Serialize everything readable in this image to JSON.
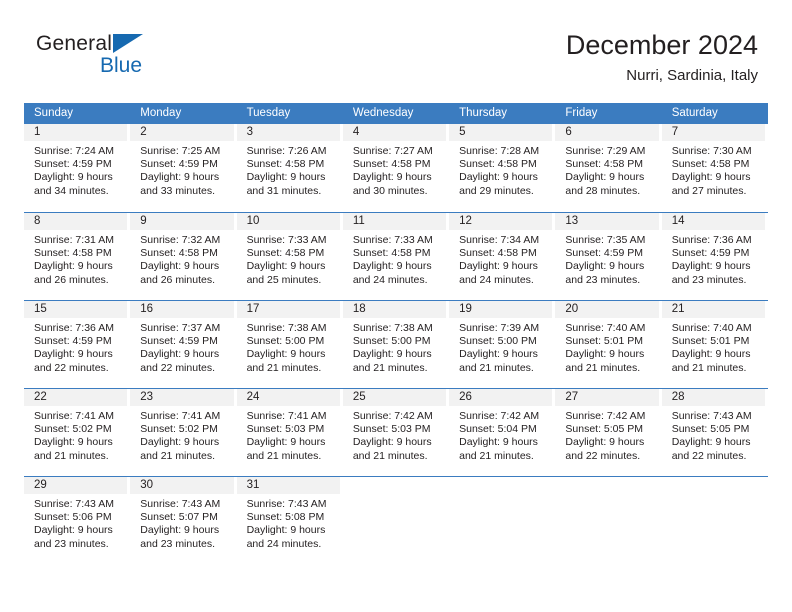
{
  "brand": {
    "line1": "General",
    "line2": "Blue",
    "triangle_color": "#1669b0"
  },
  "header": {
    "title": "December 2024",
    "subtitle": "Nurri, Sardinia, Italy",
    "accent_color": "#3b7cc0",
    "day_band_color": "#f2f2f2"
  },
  "weekday_headers": [
    "Sunday",
    "Monday",
    "Tuesday",
    "Wednesday",
    "Thursday",
    "Friday",
    "Saturday"
  ],
  "labels": {
    "sunrise_prefix": "Sunrise:",
    "sunset_prefix": "Sunset:",
    "daylight_prefix": "Daylight:"
  },
  "weeks": [
    [
      {
        "day": "1",
        "sunrise": "Sunrise: 7:24 AM",
        "sunset": "Sunset: 4:59 PM",
        "daylight_1": "Daylight: 9 hours",
        "daylight_2": "and 34 minutes."
      },
      {
        "day": "2",
        "sunrise": "Sunrise: 7:25 AM",
        "sunset": "Sunset: 4:59 PM",
        "daylight_1": "Daylight: 9 hours",
        "daylight_2": "and 33 minutes."
      },
      {
        "day": "3",
        "sunrise": "Sunrise: 7:26 AM",
        "sunset": "Sunset: 4:58 PM",
        "daylight_1": "Daylight: 9 hours",
        "daylight_2": "and 31 minutes."
      },
      {
        "day": "4",
        "sunrise": "Sunrise: 7:27 AM",
        "sunset": "Sunset: 4:58 PM",
        "daylight_1": "Daylight: 9 hours",
        "daylight_2": "and 30 minutes."
      },
      {
        "day": "5",
        "sunrise": "Sunrise: 7:28 AM",
        "sunset": "Sunset: 4:58 PM",
        "daylight_1": "Daylight: 9 hours",
        "daylight_2": "and 29 minutes."
      },
      {
        "day": "6",
        "sunrise": "Sunrise: 7:29 AM",
        "sunset": "Sunset: 4:58 PM",
        "daylight_1": "Daylight: 9 hours",
        "daylight_2": "and 28 minutes."
      },
      {
        "day": "7",
        "sunrise": "Sunrise: 7:30 AM",
        "sunset": "Sunset: 4:58 PM",
        "daylight_1": "Daylight: 9 hours",
        "daylight_2": "and 27 minutes."
      }
    ],
    [
      {
        "day": "8",
        "sunrise": "Sunrise: 7:31 AM",
        "sunset": "Sunset: 4:58 PM",
        "daylight_1": "Daylight: 9 hours",
        "daylight_2": "and 26 minutes."
      },
      {
        "day": "9",
        "sunrise": "Sunrise: 7:32 AM",
        "sunset": "Sunset: 4:58 PM",
        "daylight_1": "Daylight: 9 hours",
        "daylight_2": "and 26 minutes."
      },
      {
        "day": "10",
        "sunrise": "Sunrise: 7:33 AM",
        "sunset": "Sunset: 4:58 PM",
        "daylight_1": "Daylight: 9 hours",
        "daylight_2": "and 25 minutes."
      },
      {
        "day": "11",
        "sunrise": "Sunrise: 7:33 AM",
        "sunset": "Sunset: 4:58 PM",
        "daylight_1": "Daylight: 9 hours",
        "daylight_2": "and 24 minutes."
      },
      {
        "day": "12",
        "sunrise": "Sunrise: 7:34 AM",
        "sunset": "Sunset: 4:58 PM",
        "daylight_1": "Daylight: 9 hours",
        "daylight_2": "and 24 minutes."
      },
      {
        "day": "13",
        "sunrise": "Sunrise: 7:35 AM",
        "sunset": "Sunset: 4:59 PM",
        "daylight_1": "Daylight: 9 hours",
        "daylight_2": "and 23 minutes."
      },
      {
        "day": "14",
        "sunrise": "Sunrise: 7:36 AM",
        "sunset": "Sunset: 4:59 PM",
        "daylight_1": "Daylight: 9 hours",
        "daylight_2": "and 23 minutes."
      }
    ],
    [
      {
        "day": "15",
        "sunrise": "Sunrise: 7:36 AM",
        "sunset": "Sunset: 4:59 PM",
        "daylight_1": "Daylight: 9 hours",
        "daylight_2": "and 22 minutes."
      },
      {
        "day": "16",
        "sunrise": "Sunrise: 7:37 AM",
        "sunset": "Sunset: 4:59 PM",
        "daylight_1": "Daylight: 9 hours",
        "daylight_2": "and 22 minutes."
      },
      {
        "day": "17",
        "sunrise": "Sunrise: 7:38 AM",
        "sunset": "Sunset: 5:00 PM",
        "daylight_1": "Daylight: 9 hours",
        "daylight_2": "and 21 minutes."
      },
      {
        "day": "18",
        "sunrise": "Sunrise: 7:38 AM",
        "sunset": "Sunset: 5:00 PM",
        "daylight_1": "Daylight: 9 hours",
        "daylight_2": "and 21 minutes."
      },
      {
        "day": "19",
        "sunrise": "Sunrise: 7:39 AM",
        "sunset": "Sunset: 5:00 PM",
        "daylight_1": "Daylight: 9 hours",
        "daylight_2": "and 21 minutes."
      },
      {
        "day": "20",
        "sunrise": "Sunrise: 7:40 AM",
        "sunset": "Sunset: 5:01 PM",
        "daylight_1": "Daylight: 9 hours",
        "daylight_2": "and 21 minutes."
      },
      {
        "day": "21",
        "sunrise": "Sunrise: 7:40 AM",
        "sunset": "Sunset: 5:01 PM",
        "daylight_1": "Daylight: 9 hours",
        "daylight_2": "and 21 minutes."
      }
    ],
    [
      {
        "day": "22",
        "sunrise": "Sunrise: 7:41 AM",
        "sunset": "Sunset: 5:02 PM",
        "daylight_1": "Daylight: 9 hours",
        "daylight_2": "and 21 minutes."
      },
      {
        "day": "23",
        "sunrise": "Sunrise: 7:41 AM",
        "sunset": "Sunset: 5:02 PM",
        "daylight_1": "Daylight: 9 hours",
        "daylight_2": "and 21 minutes."
      },
      {
        "day": "24",
        "sunrise": "Sunrise: 7:41 AM",
        "sunset": "Sunset: 5:03 PM",
        "daylight_1": "Daylight: 9 hours",
        "daylight_2": "and 21 minutes."
      },
      {
        "day": "25",
        "sunrise": "Sunrise: 7:42 AM",
        "sunset": "Sunset: 5:03 PM",
        "daylight_1": "Daylight: 9 hours",
        "daylight_2": "and 21 minutes."
      },
      {
        "day": "26",
        "sunrise": "Sunrise: 7:42 AM",
        "sunset": "Sunset: 5:04 PM",
        "daylight_1": "Daylight: 9 hours",
        "daylight_2": "and 21 minutes."
      },
      {
        "day": "27",
        "sunrise": "Sunrise: 7:42 AM",
        "sunset": "Sunset: 5:05 PM",
        "daylight_1": "Daylight: 9 hours",
        "daylight_2": "and 22 minutes."
      },
      {
        "day": "28",
        "sunrise": "Sunrise: 7:43 AM",
        "sunset": "Sunset: 5:05 PM",
        "daylight_1": "Daylight: 9 hours",
        "daylight_2": "and 22 minutes."
      }
    ],
    [
      {
        "day": "29",
        "sunrise": "Sunrise: 7:43 AM",
        "sunset": "Sunset: 5:06 PM",
        "daylight_1": "Daylight: 9 hours",
        "daylight_2": "and 23 minutes."
      },
      {
        "day": "30",
        "sunrise": "Sunrise: 7:43 AM",
        "sunset": "Sunset: 5:07 PM",
        "daylight_1": "Daylight: 9 hours",
        "daylight_2": "and 23 minutes."
      },
      {
        "day": "31",
        "sunrise": "Sunrise: 7:43 AM",
        "sunset": "Sunset: 5:08 PM",
        "daylight_1": "Daylight: 9 hours",
        "daylight_2": "and 24 minutes."
      },
      {
        "day": "",
        "sunrise": "",
        "sunset": "",
        "daylight_1": "",
        "daylight_2": ""
      },
      {
        "day": "",
        "sunrise": "",
        "sunset": "",
        "daylight_1": "",
        "daylight_2": ""
      },
      {
        "day": "",
        "sunrise": "",
        "sunset": "",
        "daylight_1": "",
        "daylight_2": ""
      },
      {
        "day": "",
        "sunrise": "",
        "sunset": "",
        "daylight_1": "",
        "daylight_2": ""
      }
    ]
  ]
}
